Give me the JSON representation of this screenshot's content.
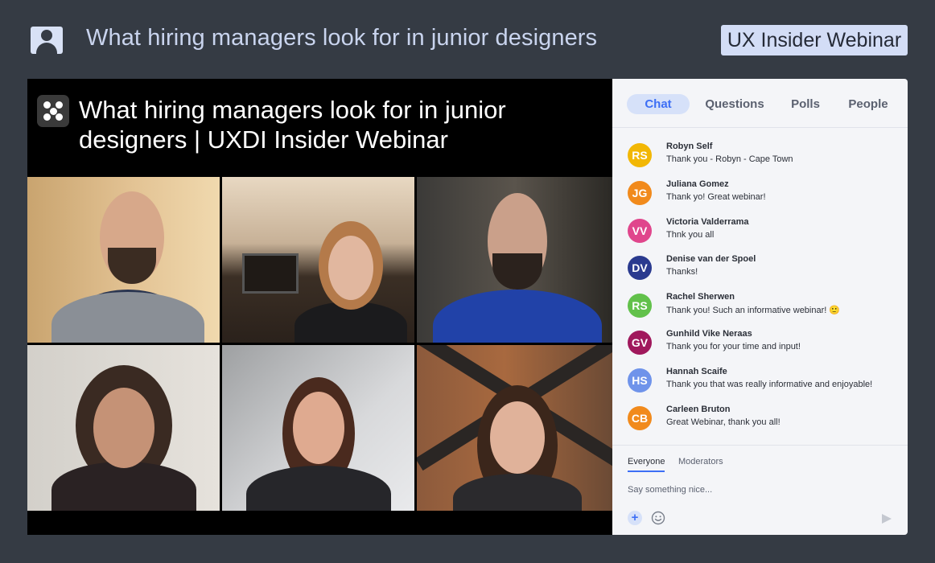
{
  "header": {
    "title": "What hiring managers look for in junior designers",
    "badge": "UX Insider Webinar",
    "icon": "user-profile-icon"
  },
  "video": {
    "title": "What hiring managers look for in junior designers | UXDI Insider Webinar",
    "logo_icon": "dots-logo-icon",
    "participants": 6
  },
  "panel": {
    "tabs": [
      {
        "label": "Chat",
        "active": true
      },
      {
        "label": "Questions",
        "active": false
      },
      {
        "label": "Polls",
        "active": false
      },
      {
        "label": "People",
        "active": false
      }
    ],
    "messages": [
      {
        "initials": "RS",
        "name": "Robyn Self",
        "text": "Thank you - Robyn - Cape Town",
        "color": "#f2b705"
      },
      {
        "initials": "JG",
        "name": "Juliana Gomez",
        "text": "Thank yo! Great webinar!",
        "color": "#f18a1c"
      },
      {
        "initials": "VV",
        "name": "Victoria Valderrama",
        "text": "Thnk you all",
        "color": "#e0468c"
      },
      {
        "initials": "DV",
        "name": "Denise van der Spoel",
        "text": "Thanks!",
        "color": "#2a3a8f"
      },
      {
        "initials": "RS",
        "name": "Rachel Sherwen",
        "text": "Thank you! Such an informative webinar! 🙂",
        "color": "#62c14b"
      },
      {
        "initials": "GV",
        "name": "Gunhild Vike Neraas",
        "text": "Thank you for your time and input!",
        "color": "#a0185c"
      },
      {
        "initials": "HS",
        "name": "Hannah Scaife",
        "text": "Thank you that was really informative and enjoyable!",
        "color": "#6f93ea"
      },
      {
        "initials": "CB",
        "name": "Carleen Bruton",
        "text": "Great Webinar, thank you all!",
        "color": "#f18a1c"
      }
    ],
    "compose": {
      "tabs": [
        {
          "label": "Everyone",
          "active": true
        },
        {
          "label": "Moderators",
          "active": false
        }
      ],
      "placeholder": "Say something nice...",
      "add_icon": "plus-icon",
      "emoji_icon": "smiley-icon",
      "send_icon": "send-icon"
    }
  }
}
